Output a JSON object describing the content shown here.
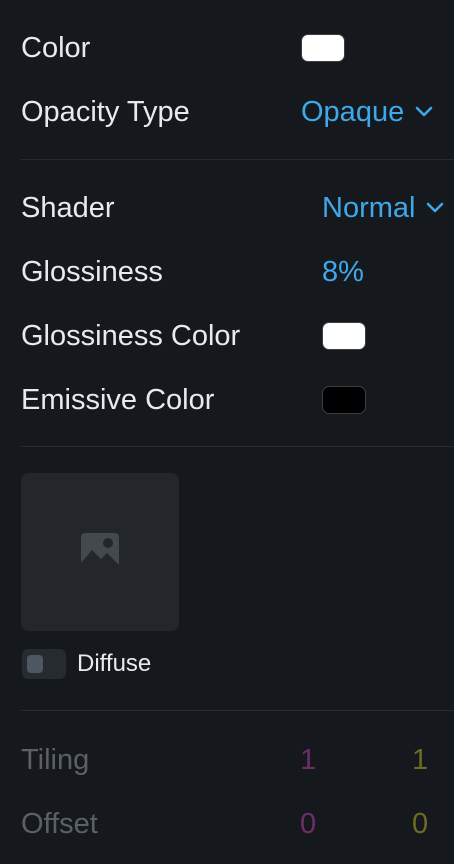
{
  "colors": {
    "background": "#15191d",
    "text": "#e8eaec",
    "text_dim": "#5b6065",
    "accent": "#3ea8e8",
    "divider": "#262b30",
    "tiling_x": "#6e2d69",
    "tiling_y": "#6b6b24"
  },
  "color_row": {
    "label": "Color",
    "swatch_color": "#ffffff"
  },
  "opacity_row": {
    "label": "Opacity Type",
    "value": "Opaque",
    "icon": "chevron-down-icon"
  },
  "shader_row": {
    "label": "Shader",
    "value": "Normal",
    "icon": "chevron-down-icon"
  },
  "glossiness_row": {
    "label": "Glossiness",
    "value": "8%"
  },
  "glossiness_color_row": {
    "label": "Glossiness Color",
    "swatch_color": "#ffffff"
  },
  "emissive_color_row": {
    "label": "Emissive Color",
    "swatch_color": "#000000"
  },
  "texture": {
    "icon": "image-icon",
    "toggle_label": "Diffuse",
    "toggle_on": false
  },
  "tiling_row": {
    "label": "Tiling",
    "x": "1",
    "y": "1"
  },
  "offset_row": {
    "label": "Offset",
    "x": "0",
    "y": "0"
  }
}
